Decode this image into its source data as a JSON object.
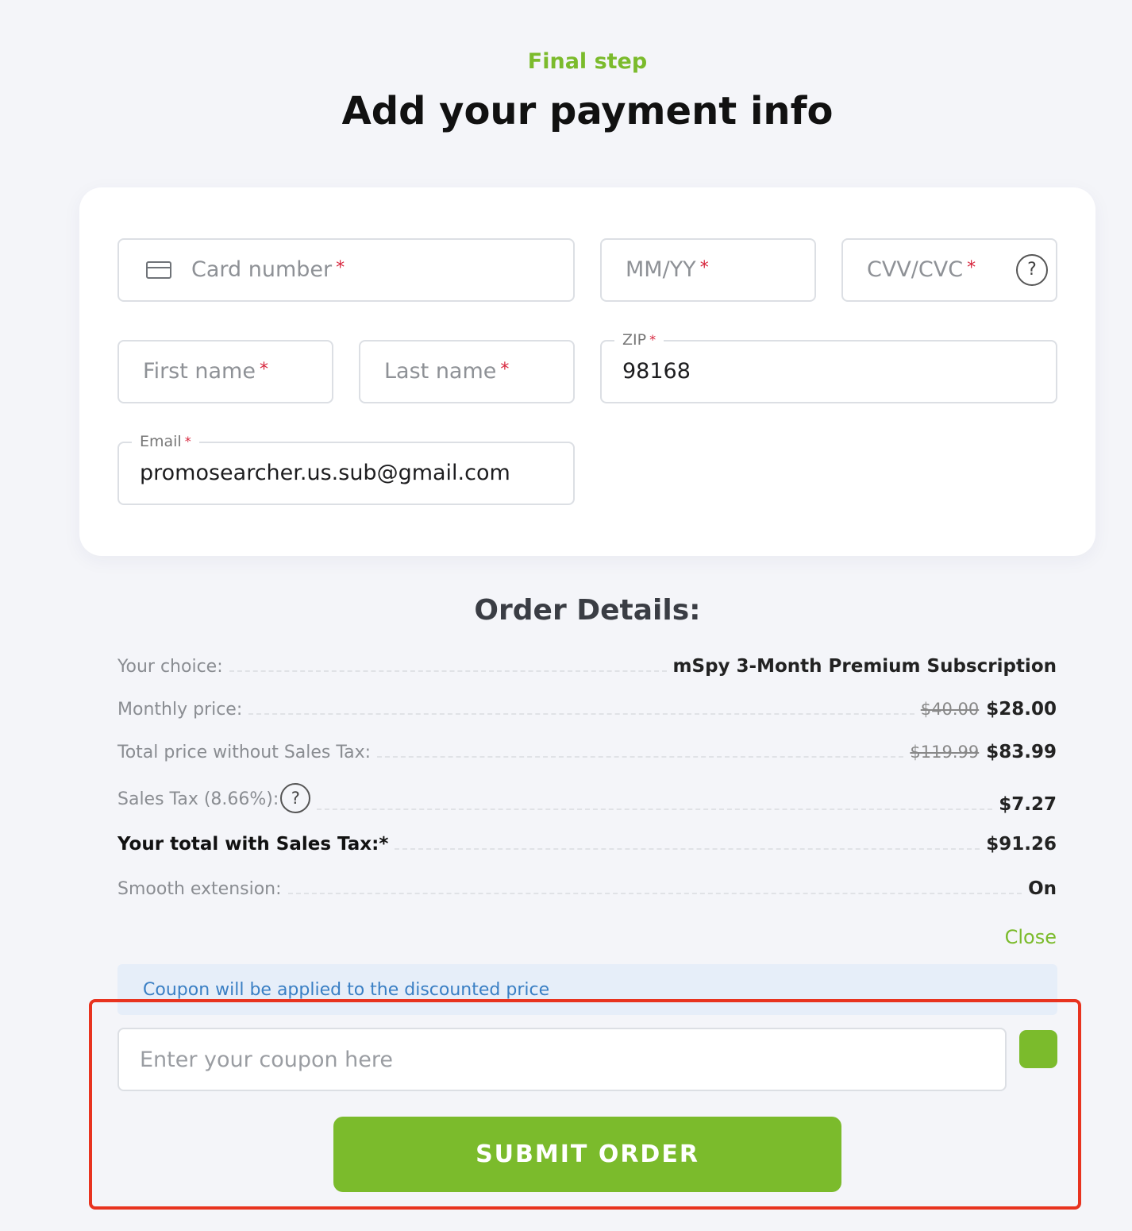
{
  "header": {
    "step_label": "Final step",
    "title": "Add your payment info"
  },
  "form": {
    "card_number": {
      "placeholder": "Card number",
      "required_mark": "*",
      "icon": "credit-card-icon"
    },
    "expiry": {
      "placeholder": "MM/YY",
      "required_mark": "*"
    },
    "cvv": {
      "placeholder": "CVV/CVC",
      "required_mark": "*",
      "help_icon": "?"
    },
    "first_name": {
      "placeholder": "First name",
      "required_mark": "*"
    },
    "last_name": {
      "placeholder": "Last name",
      "required_mark": "*"
    },
    "zip": {
      "label": "ZIP",
      "required_mark": "*",
      "value": "98168"
    },
    "email": {
      "label": "Email",
      "required_mark": "*",
      "value": "promosearcher.us.sub@gmail.com"
    }
  },
  "order": {
    "title": "Order Details:",
    "rows": [
      {
        "label": "Your choice:",
        "value": "mSpy 3-Month Premium Subscription"
      },
      {
        "label": "Monthly price:",
        "old": "$40.00",
        "value": "$28.00"
      },
      {
        "label": "Total price without Sales Tax:",
        "old": "$119.99",
        "value": "$83.99"
      },
      {
        "label": "Sales Tax (8.66%):",
        "help_icon": "?",
        "value": "$7.27"
      },
      {
        "label": "Your total with Sales Tax:*",
        "value": "$91.26"
      },
      {
        "label": "Smooth extension:",
        "value": "On"
      }
    ],
    "close_label": "Close"
  },
  "coupon": {
    "note": "Coupon will be applied to the discounted price",
    "placeholder": "Enter your coupon here"
  },
  "submit_label": "SUBMIT ORDER",
  "colors": {
    "accent": "#7bbb2c",
    "required": "#d7263d",
    "highlight_box": "#e8331f",
    "note_bg": "#e6eef9",
    "note_text": "#3a7fc4"
  }
}
